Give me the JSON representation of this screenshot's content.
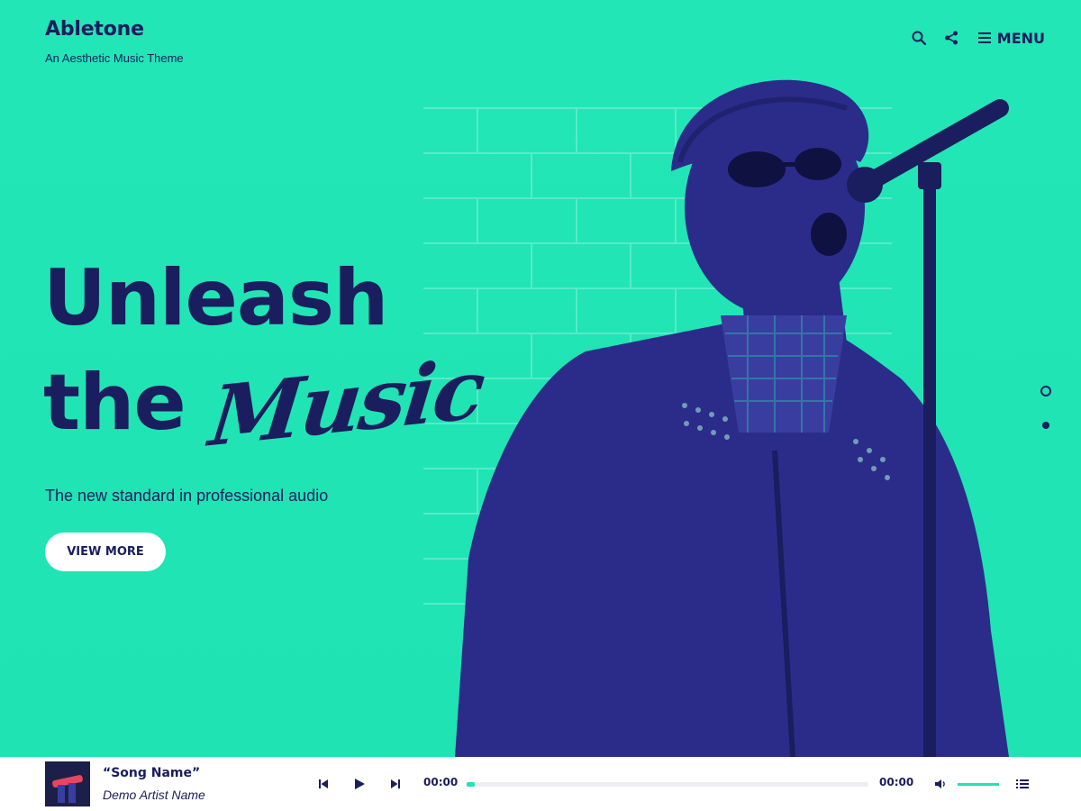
{
  "brand": {
    "title": "Abletone",
    "subtitle": "An Aesthetic Music Theme"
  },
  "nav": {
    "search_icon": "search-icon",
    "share_icon": "share-icon",
    "menu_label": "MENU"
  },
  "hero": {
    "headline_line1": "Unleash",
    "headline_line2": "the",
    "headline_script": "Music",
    "subtitle": "The new standard in professional audio",
    "cta_label": "VIEW MORE",
    "slides_total": 2,
    "active_slide": 2
  },
  "player": {
    "song_name": "“Song Name”",
    "artist_name": "Demo Artist Name",
    "current_time": "00:00",
    "duration": "00:00",
    "progress": 0.02,
    "volume": 1.0
  },
  "colors": {
    "accent": "#1fe3b3",
    "dark": "#1a1d5e",
    "white": "#ffffff"
  }
}
